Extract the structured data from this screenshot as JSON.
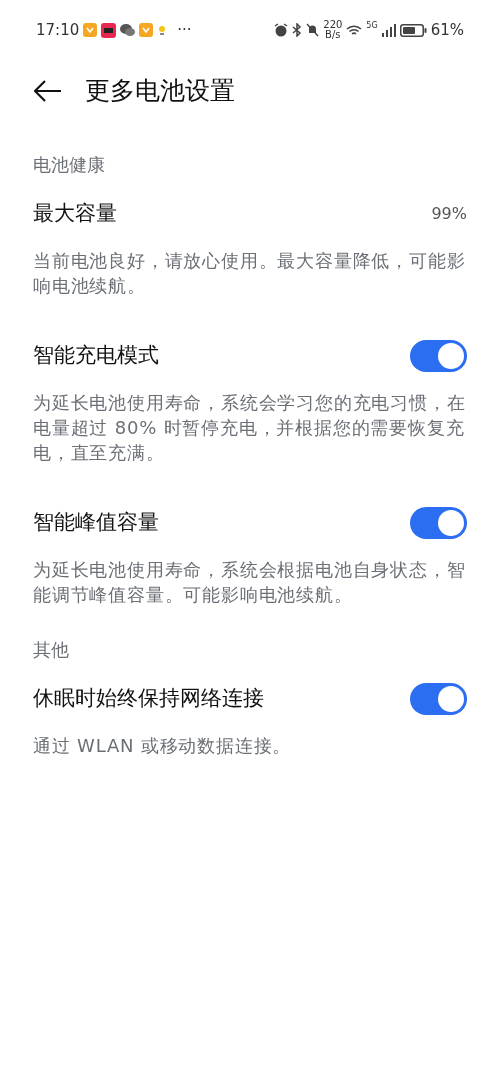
{
  "status_bar": {
    "time": "17:10",
    "more": "···",
    "net_speed": "220",
    "net_unit": "B/s",
    "network": "5G",
    "battery": "61%"
  },
  "header": {
    "title": "更多电池设置"
  },
  "sections": [
    {
      "heading": "电池健康",
      "items": [
        {
          "kind": "value",
          "title": "最大容量",
          "value": "99%",
          "description": "当前电池良好，请放心使用。最大容量降低，可能影响电池续航。"
        },
        {
          "kind": "toggle",
          "title": "智能充电模式",
          "on": true,
          "description": "为延长电池使用寿命，系统会学习您的充电习惯，在电量超过 80% 时暂停充电，并根据您的需要恢复充电，直至充满。"
        },
        {
          "kind": "toggle",
          "title": "智能峰值容量",
          "on": true,
          "description": "为延长电池使用寿命，系统会根据电池自身状态，智能调节峰值容量。可能影响电池续航。"
        }
      ]
    },
    {
      "heading": "其他",
      "items": [
        {
          "kind": "toggle",
          "title": "休眠时始终保持网络连接",
          "on": true,
          "description": "通过 WLAN 或移动数据连接。"
        }
      ]
    }
  ]
}
